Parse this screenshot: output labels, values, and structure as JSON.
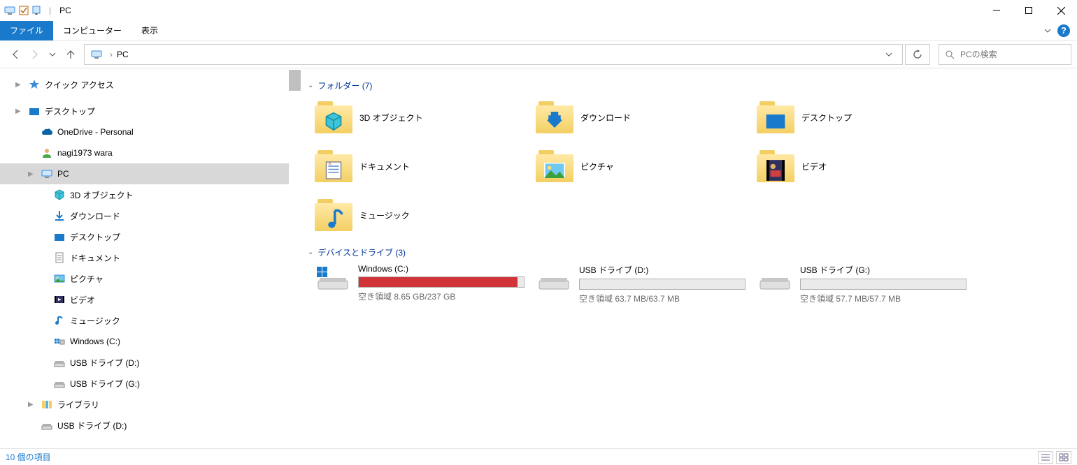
{
  "window": {
    "title": "PC"
  },
  "ribbon": {
    "file": "ファイル",
    "computer": "コンピューター",
    "view": "表示"
  },
  "addr": {
    "location": "PC"
  },
  "search": {
    "placeholder": "PCの検索"
  },
  "nav": {
    "quick_access": "クイック アクセス",
    "desktop": "デスクトップ",
    "onedrive": "OneDrive - Personal",
    "user": "nagi1973 wara",
    "pc": "PC",
    "pc_children": {
      "objects3d": "3D オブジェクト",
      "downloads": "ダウンロード",
      "desktop": "デスクトップ",
      "documents": "ドキュメント",
      "pictures": "ピクチャ",
      "videos": "ビデオ",
      "music": "ミュージック",
      "drive_c": "Windows (C:)",
      "drive_d": "USB ドライブ (D:)",
      "drive_g": "USB ドライブ (G:)"
    },
    "libraries": "ライブラリ",
    "lib_drive_d": "USB ドライブ (D:)"
  },
  "groups": {
    "folders": "フォルダー (7)",
    "devices": "デバイスとドライブ (3)"
  },
  "folders": {
    "objects3d": "3D オブジェクト",
    "downloads": "ダウンロード",
    "desktop": "デスクトップ",
    "documents": "ドキュメント",
    "pictures": "ピクチャ",
    "videos": "ビデオ",
    "music": "ミュージック"
  },
  "drives": {
    "c": {
      "name": "Windows (C:)",
      "free": "空き領域 8.65 GB/237 GB",
      "fill_pct": 96,
      "color": "red"
    },
    "d": {
      "name": "USB ドライブ (D:)",
      "free": "空き領域 63.7 MB/63.7 MB",
      "fill_pct": 0,
      "color": "blue"
    },
    "g": {
      "name": "USB ドライブ (G:)",
      "free": "空き領域 57.7 MB/57.7 MB",
      "fill_pct": 0,
      "color": "blue"
    }
  },
  "status": {
    "items": "10 個の項目"
  }
}
